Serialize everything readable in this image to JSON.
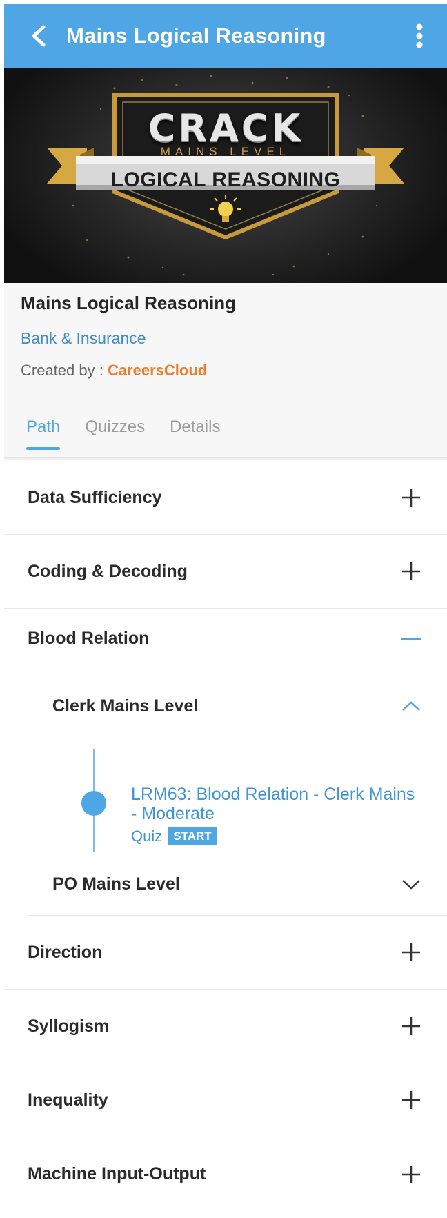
{
  "appbar": {
    "title": "Mains Logical Reasoning",
    "back_icon": "chevron-left-icon",
    "menu_icon": "more-vertical-icon",
    "color": "#4ea6e4"
  },
  "banner": {
    "line1": "CRACK",
    "line2": "MAINS LEVEL",
    "line3": "LOGICAL REASONING",
    "icon": "lightbulb-icon"
  },
  "course": {
    "title": "Mains Logical Reasoning",
    "category": "Bank & Insurance",
    "created_by_label": "Created by : ",
    "creator": "CareersCloud"
  },
  "tabs": [
    {
      "label": "Path",
      "active": true
    },
    {
      "label": "Quizzes",
      "active": false
    },
    {
      "label": "Details",
      "active": false
    }
  ],
  "topics": [
    {
      "label": "Data Sufficiency",
      "state": "collapsed"
    },
    {
      "label": "Coding & Decoding",
      "state": "collapsed"
    },
    {
      "label": "Blood Relation",
      "state": "expanded"
    },
    {
      "label": "Direction",
      "state": "collapsed"
    },
    {
      "label": "Syllogism",
      "state": "collapsed"
    },
    {
      "label": "Inequality",
      "state": "collapsed"
    },
    {
      "label": "Machine Input-Output",
      "state": "collapsed"
    }
  ],
  "blood_relation": {
    "subsections": [
      {
        "label": "Clerk Mains Level",
        "state": "expanded"
      },
      {
        "label": "PO Mains Level",
        "state": "collapsed"
      }
    ],
    "items": [
      {
        "title": "LRM63: Blood Relation - Clerk Mains - Moderate",
        "type": "Quiz",
        "action": "START"
      }
    ]
  }
}
